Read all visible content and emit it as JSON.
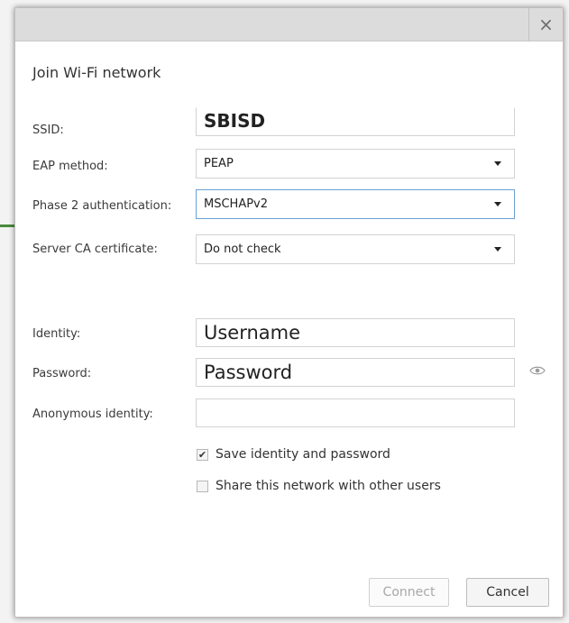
{
  "dialog": {
    "title": "Join Wi-Fi network",
    "close_icon": "close-icon",
    "close_glyph": "×"
  },
  "fields": {
    "ssid": {
      "label": "SSID:",
      "value": "SBISD"
    },
    "eap_method": {
      "label": "EAP method:",
      "value": "PEAP"
    },
    "phase2": {
      "label": "Phase 2 authentication:",
      "value": "MSCHAPv2"
    },
    "server_ca": {
      "label": "Server CA certificate:",
      "value": "Do not check"
    },
    "identity": {
      "label": "Identity:",
      "value": "Username"
    },
    "password": {
      "label": "Password:",
      "value": "Password",
      "toggle_icon": "eye-icon"
    },
    "anonymous_identity": {
      "label": "Anonymous identity:",
      "value": ""
    }
  },
  "checkboxes": {
    "save_identity": {
      "label": "Save identity and password",
      "checked": true,
      "check_glyph": "✔"
    },
    "share_network": {
      "label": "Share this network with other users",
      "checked": false
    }
  },
  "buttons": {
    "connect": {
      "label": "Connect",
      "disabled": true
    },
    "cancel": {
      "label": "Cancel"
    }
  },
  "colors": {
    "titlebar": "#dcdcdc",
    "focus_border": "#6b9fd6",
    "disabled_text": "#a8a8a8"
  }
}
